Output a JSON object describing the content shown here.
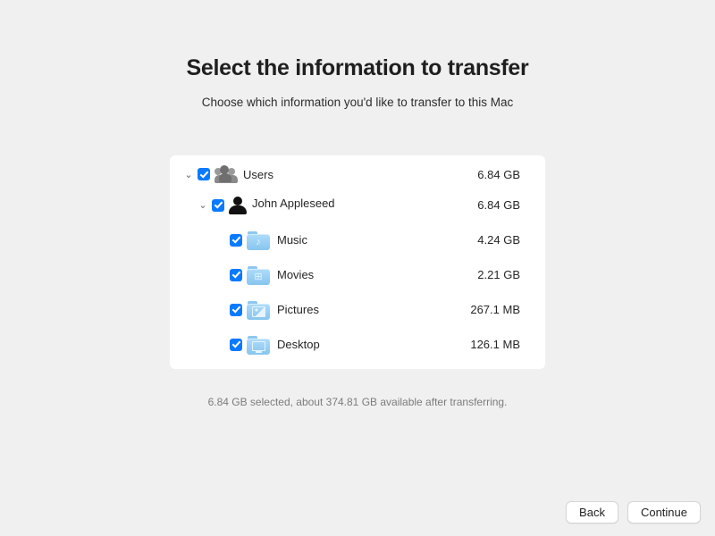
{
  "title": "Select the information to transfer",
  "subtitle": "Choose which information you'd like to transfer to this Mac",
  "tree": {
    "users": {
      "label": "Users",
      "size": "6.84 GB"
    },
    "user": {
      "label": "John Appleseed",
      "size": "6.84 GB"
    },
    "items": [
      {
        "label": "Music",
        "size": "4.24 GB",
        "glyph": "♪"
      },
      {
        "label": "Movies",
        "size": "2.21 GB",
        "glyph": "⊞"
      },
      {
        "label": "Pictures",
        "size": "267.1 MB",
        "glyph": "pic"
      },
      {
        "label": "Desktop",
        "size": "126.1 MB",
        "glyph": "desk"
      }
    ]
  },
  "summary": "6.84 GB selected, about 374.81 GB available after transferring.",
  "buttons": {
    "back": "Back",
    "continue": "Continue"
  }
}
